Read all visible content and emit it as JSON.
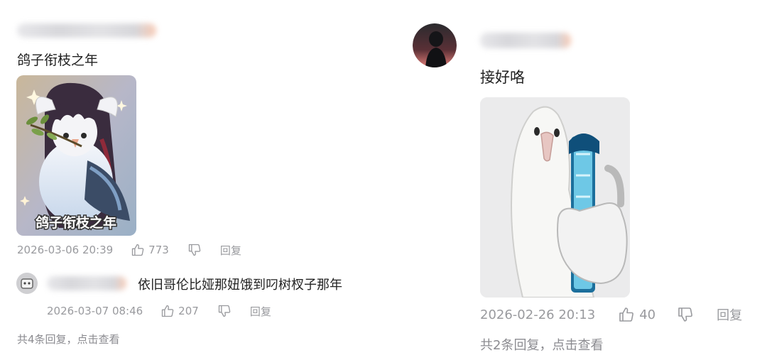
{
  "left_comment": {
    "text": "鸽子衔枝之年",
    "image_caption": "鸽子衔枝之年",
    "timestamp": "2026-03-06 20:39",
    "likes": "773",
    "reply_label": "回复",
    "sub_reply": {
      "text": "依旧哥伦比娅那妞饿到叼树杈子那年",
      "timestamp": "2026-03-07 08:46",
      "likes": "207",
      "reply_label": "回复"
    },
    "replies_summary": "共4条回复，点击查看"
  },
  "right_comment": {
    "text": "接好咯",
    "timestamp": "2026-02-26 20:13",
    "likes": "40",
    "reply_label": "回复",
    "replies_summary": "共2条回复，点击查看"
  },
  "icons": {
    "like": "thumbs-up-icon",
    "dislike": "thumbs-down-icon"
  },
  "colors": {
    "meta_text": "#999a9e",
    "body_text": "#222222"
  }
}
